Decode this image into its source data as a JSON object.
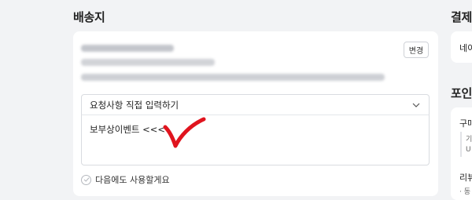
{
  "shipping": {
    "title": "배송지",
    "change_label": "변경",
    "request_select": "요청사항 직접 입력하기",
    "request_text": "보부상이벤트 <<<",
    "save_next_label": "다음에도 사용할게요"
  },
  "side": {
    "payment_title": "결제",
    "payment_method": "네이",
    "points_title": "포인",
    "purchase_label": "구매",
    "purchase_line1": "기",
    "purchase_line2": "U",
    "review_label": "리뷰",
    "review_sub": "· 동"
  },
  "colors": {
    "background": "#f2f3f5",
    "card": "#ffffff",
    "annotation": "#e0141e"
  },
  "icons": {
    "chevron": "chevron-down-icon",
    "check": "check-circle-icon",
    "annotation": "red-checkmark"
  }
}
